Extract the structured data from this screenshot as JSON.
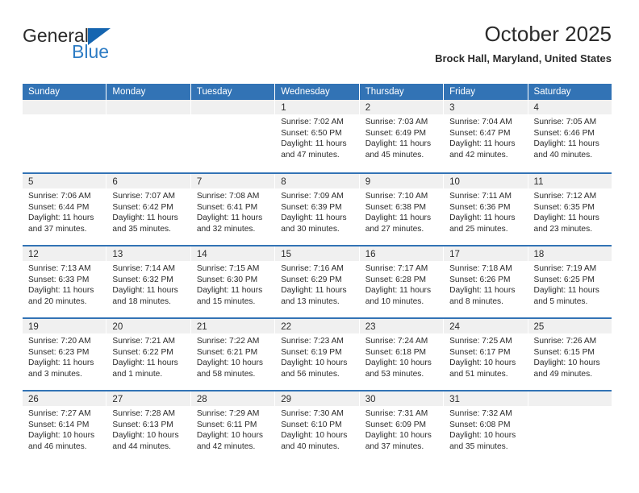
{
  "brand": {
    "name_part1": "General",
    "name_part2": "Blue",
    "triangle_color": "#1565b0",
    "blue_color": "#2d7cc4"
  },
  "header": {
    "title": "October 2025",
    "location": "Brock Hall, Maryland, United States"
  },
  "theme": {
    "header_blue": "#3273b5",
    "day_band_gray": "#f0f0f0",
    "text_color": "#2b2b2b"
  },
  "labels": {
    "sunrise_prefix": "Sunrise: ",
    "sunset_prefix": "Sunset: ",
    "daylight_prefix": "Daylight: "
  },
  "weekdays": [
    "Sunday",
    "Monday",
    "Tuesday",
    "Wednesday",
    "Thursday",
    "Friday",
    "Saturday"
  ],
  "weeks": [
    [
      {
        "day": "",
        "sunrise": "",
        "sunset": "",
        "daylight1": "",
        "daylight2": ""
      },
      {
        "day": "",
        "sunrise": "",
        "sunset": "",
        "daylight1": "",
        "daylight2": ""
      },
      {
        "day": "",
        "sunrise": "",
        "sunset": "",
        "daylight1": "",
        "daylight2": ""
      },
      {
        "day": "1",
        "sunrise": "Sunrise: 7:02 AM",
        "sunset": "Sunset: 6:50 PM",
        "daylight1": "Daylight: 11 hours",
        "daylight2": "and 47 minutes."
      },
      {
        "day": "2",
        "sunrise": "Sunrise: 7:03 AM",
        "sunset": "Sunset: 6:49 PM",
        "daylight1": "Daylight: 11 hours",
        "daylight2": "and 45 minutes."
      },
      {
        "day": "3",
        "sunrise": "Sunrise: 7:04 AM",
        "sunset": "Sunset: 6:47 PM",
        "daylight1": "Daylight: 11 hours",
        "daylight2": "and 42 minutes."
      },
      {
        "day": "4",
        "sunrise": "Sunrise: 7:05 AM",
        "sunset": "Sunset: 6:46 PM",
        "daylight1": "Daylight: 11 hours",
        "daylight2": "and 40 minutes."
      }
    ],
    [
      {
        "day": "5",
        "sunrise": "Sunrise: 7:06 AM",
        "sunset": "Sunset: 6:44 PM",
        "daylight1": "Daylight: 11 hours",
        "daylight2": "and 37 minutes."
      },
      {
        "day": "6",
        "sunrise": "Sunrise: 7:07 AM",
        "sunset": "Sunset: 6:42 PM",
        "daylight1": "Daylight: 11 hours",
        "daylight2": "and 35 minutes."
      },
      {
        "day": "7",
        "sunrise": "Sunrise: 7:08 AM",
        "sunset": "Sunset: 6:41 PM",
        "daylight1": "Daylight: 11 hours",
        "daylight2": "and 32 minutes."
      },
      {
        "day": "8",
        "sunrise": "Sunrise: 7:09 AM",
        "sunset": "Sunset: 6:39 PM",
        "daylight1": "Daylight: 11 hours",
        "daylight2": "and 30 minutes."
      },
      {
        "day": "9",
        "sunrise": "Sunrise: 7:10 AM",
        "sunset": "Sunset: 6:38 PM",
        "daylight1": "Daylight: 11 hours",
        "daylight2": "and 27 minutes."
      },
      {
        "day": "10",
        "sunrise": "Sunrise: 7:11 AM",
        "sunset": "Sunset: 6:36 PM",
        "daylight1": "Daylight: 11 hours",
        "daylight2": "and 25 minutes."
      },
      {
        "day": "11",
        "sunrise": "Sunrise: 7:12 AM",
        "sunset": "Sunset: 6:35 PM",
        "daylight1": "Daylight: 11 hours",
        "daylight2": "and 23 minutes."
      }
    ],
    [
      {
        "day": "12",
        "sunrise": "Sunrise: 7:13 AM",
        "sunset": "Sunset: 6:33 PM",
        "daylight1": "Daylight: 11 hours",
        "daylight2": "and 20 minutes."
      },
      {
        "day": "13",
        "sunrise": "Sunrise: 7:14 AM",
        "sunset": "Sunset: 6:32 PM",
        "daylight1": "Daylight: 11 hours",
        "daylight2": "and 18 minutes."
      },
      {
        "day": "14",
        "sunrise": "Sunrise: 7:15 AM",
        "sunset": "Sunset: 6:30 PM",
        "daylight1": "Daylight: 11 hours",
        "daylight2": "and 15 minutes."
      },
      {
        "day": "15",
        "sunrise": "Sunrise: 7:16 AM",
        "sunset": "Sunset: 6:29 PM",
        "daylight1": "Daylight: 11 hours",
        "daylight2": "and 13 minutes."
      },
      {
        "day": "16",
        "sunrise": "Sunrise: 7:17 AM",
        "sunset": "Sunset: 6:28 PM",
        "daylight1": "Daylight: 11 hours",
        "daylight2": "and 10 minutes."
      },
      {
        "day": "17",
        "sunrise": "Sunrise: 7:18 AM",
        "sunset": "Sunset: 6:26 PM",
        "daylight1": "Daylight: 11 hours",
        "daylight2": "and 8 minutes."
      },
      {
        "day": "18",
        "sunrise": "Sunrise: 7:19 AM",
        "sunset": "Sunset: 6:25 PM",
        "daylight1": "Daylight: 11 hours",
        "daylight2": "and 5 minutes."
      }
    ],
    [
      {
        "day": "19",
        "sunrise": "Sunrise: 7:20 AM",
        "sunset": "Sunset: 6:23 PM",
        "daylight1": "Daylight: 11 hours",
        "daylight2": "and 3 minutes."
      },
      {
        "day": "20",
        "sunrise": "Sunrise: 7:21 AM",
        "sunset": "Sunset: 6:22 PM",
        "daylight1": "Daylight: 11 hours",
        "daylight2": "and 1 minute."
      },
      {
        "day": "21",
        "sunrise": "Sunrise: 7:22 AM",
        "sunset": "Sunset: 6:21 PM",
        "daylight1": "Daylight: 10 hours",
        "daylight2": "and 58 minutes."
      },
      {
        "day": "22",
        "sunrise": "Sunrise: 7:23 AM",
        "sunset": "Sunset: 6:19 PM",
        "daylight1": "Daylight: 10 hours",
        "daylight2": "and 56 minutes."
      },
      {
        "day": "23",
        "sunrise": "Sunrise: 7:24 AM",
        "sunset": "Sunset: 6:18 PM",
        "daylight1": "Daylight: 10 hours",
        "daylight2": "and 53 minutes."
      },
      {
        "day": "24",
        "sunrise": "Sunrise: 7:25 AM",
        "sunset": "Sunset: 6:17 PM",
        "daylight1": "Daylight: 10 hours",
        "daylight2": "and 51 minutes."
      },
      {
        "day": "25",
        "sunrise": "Sunrise: 7:26 AM",
        "sunset": "Sunset: 6:15 PM",
        "daylight1": "Daylight: 10 hours",
        "daylight2": "and 49 minutes."
      }
    ],
    [
      {
        "day": "26",
        "sunrise": "Sunrise: 7:27 AM",
        "sunset": "Sunset: 6:14 PM",
        "daylight1": "Daylight: 10 hours",
        "daylight2": "and 46 minutes."
      },
      {
        "day": "27",
        "sunrise": "Sunrise: 7:28 AM",
        "sunset": "Sunset: 6:13 PM",
        "daylight1": "Daylight: 10 hours",
        "daylight2": "and 44 minutes."
      },
      {
        "day": "28",
        "sunrise": "Sunrise: 7:29 AM",
        "sunset": "Sunset: 6:11 PM",
        "daylight1": "Daylight: 10 hours",
        "daylight2": "and 42 minutes."
      },
      {
        "day": "29",
        "sunrise": "Sunrise: 7:30 AM",
        "sunset": "Sunset: 6:10 PM",
        "daylight1": "Daylight: 10 hours",
        "daylight2": "and 40 minutes."
      },
      {
        "day": "30",
        "sunrise": "Sunrise: 7:31 AM",
        "sunset": "Sunset: 6:09 PM",
        "daylight1": "Daylight: 10 hours",
        "daylight2": "and 37 minutes."
      },
      {
        "day": "31",
        "sunrise": "Sunrise: 7:32 AM",
        "sunset": "Sunset: 6:08 PM",
        "daylight1": "Daylight: 10 hours",
        "daylight2": "and 35 minutes."
      },
      {
        "day": "",
        "sunrise": "",
        "sunset": "",
        "daylight1": "",
        "daylight2": ""
      }
    ]
  ]
}
